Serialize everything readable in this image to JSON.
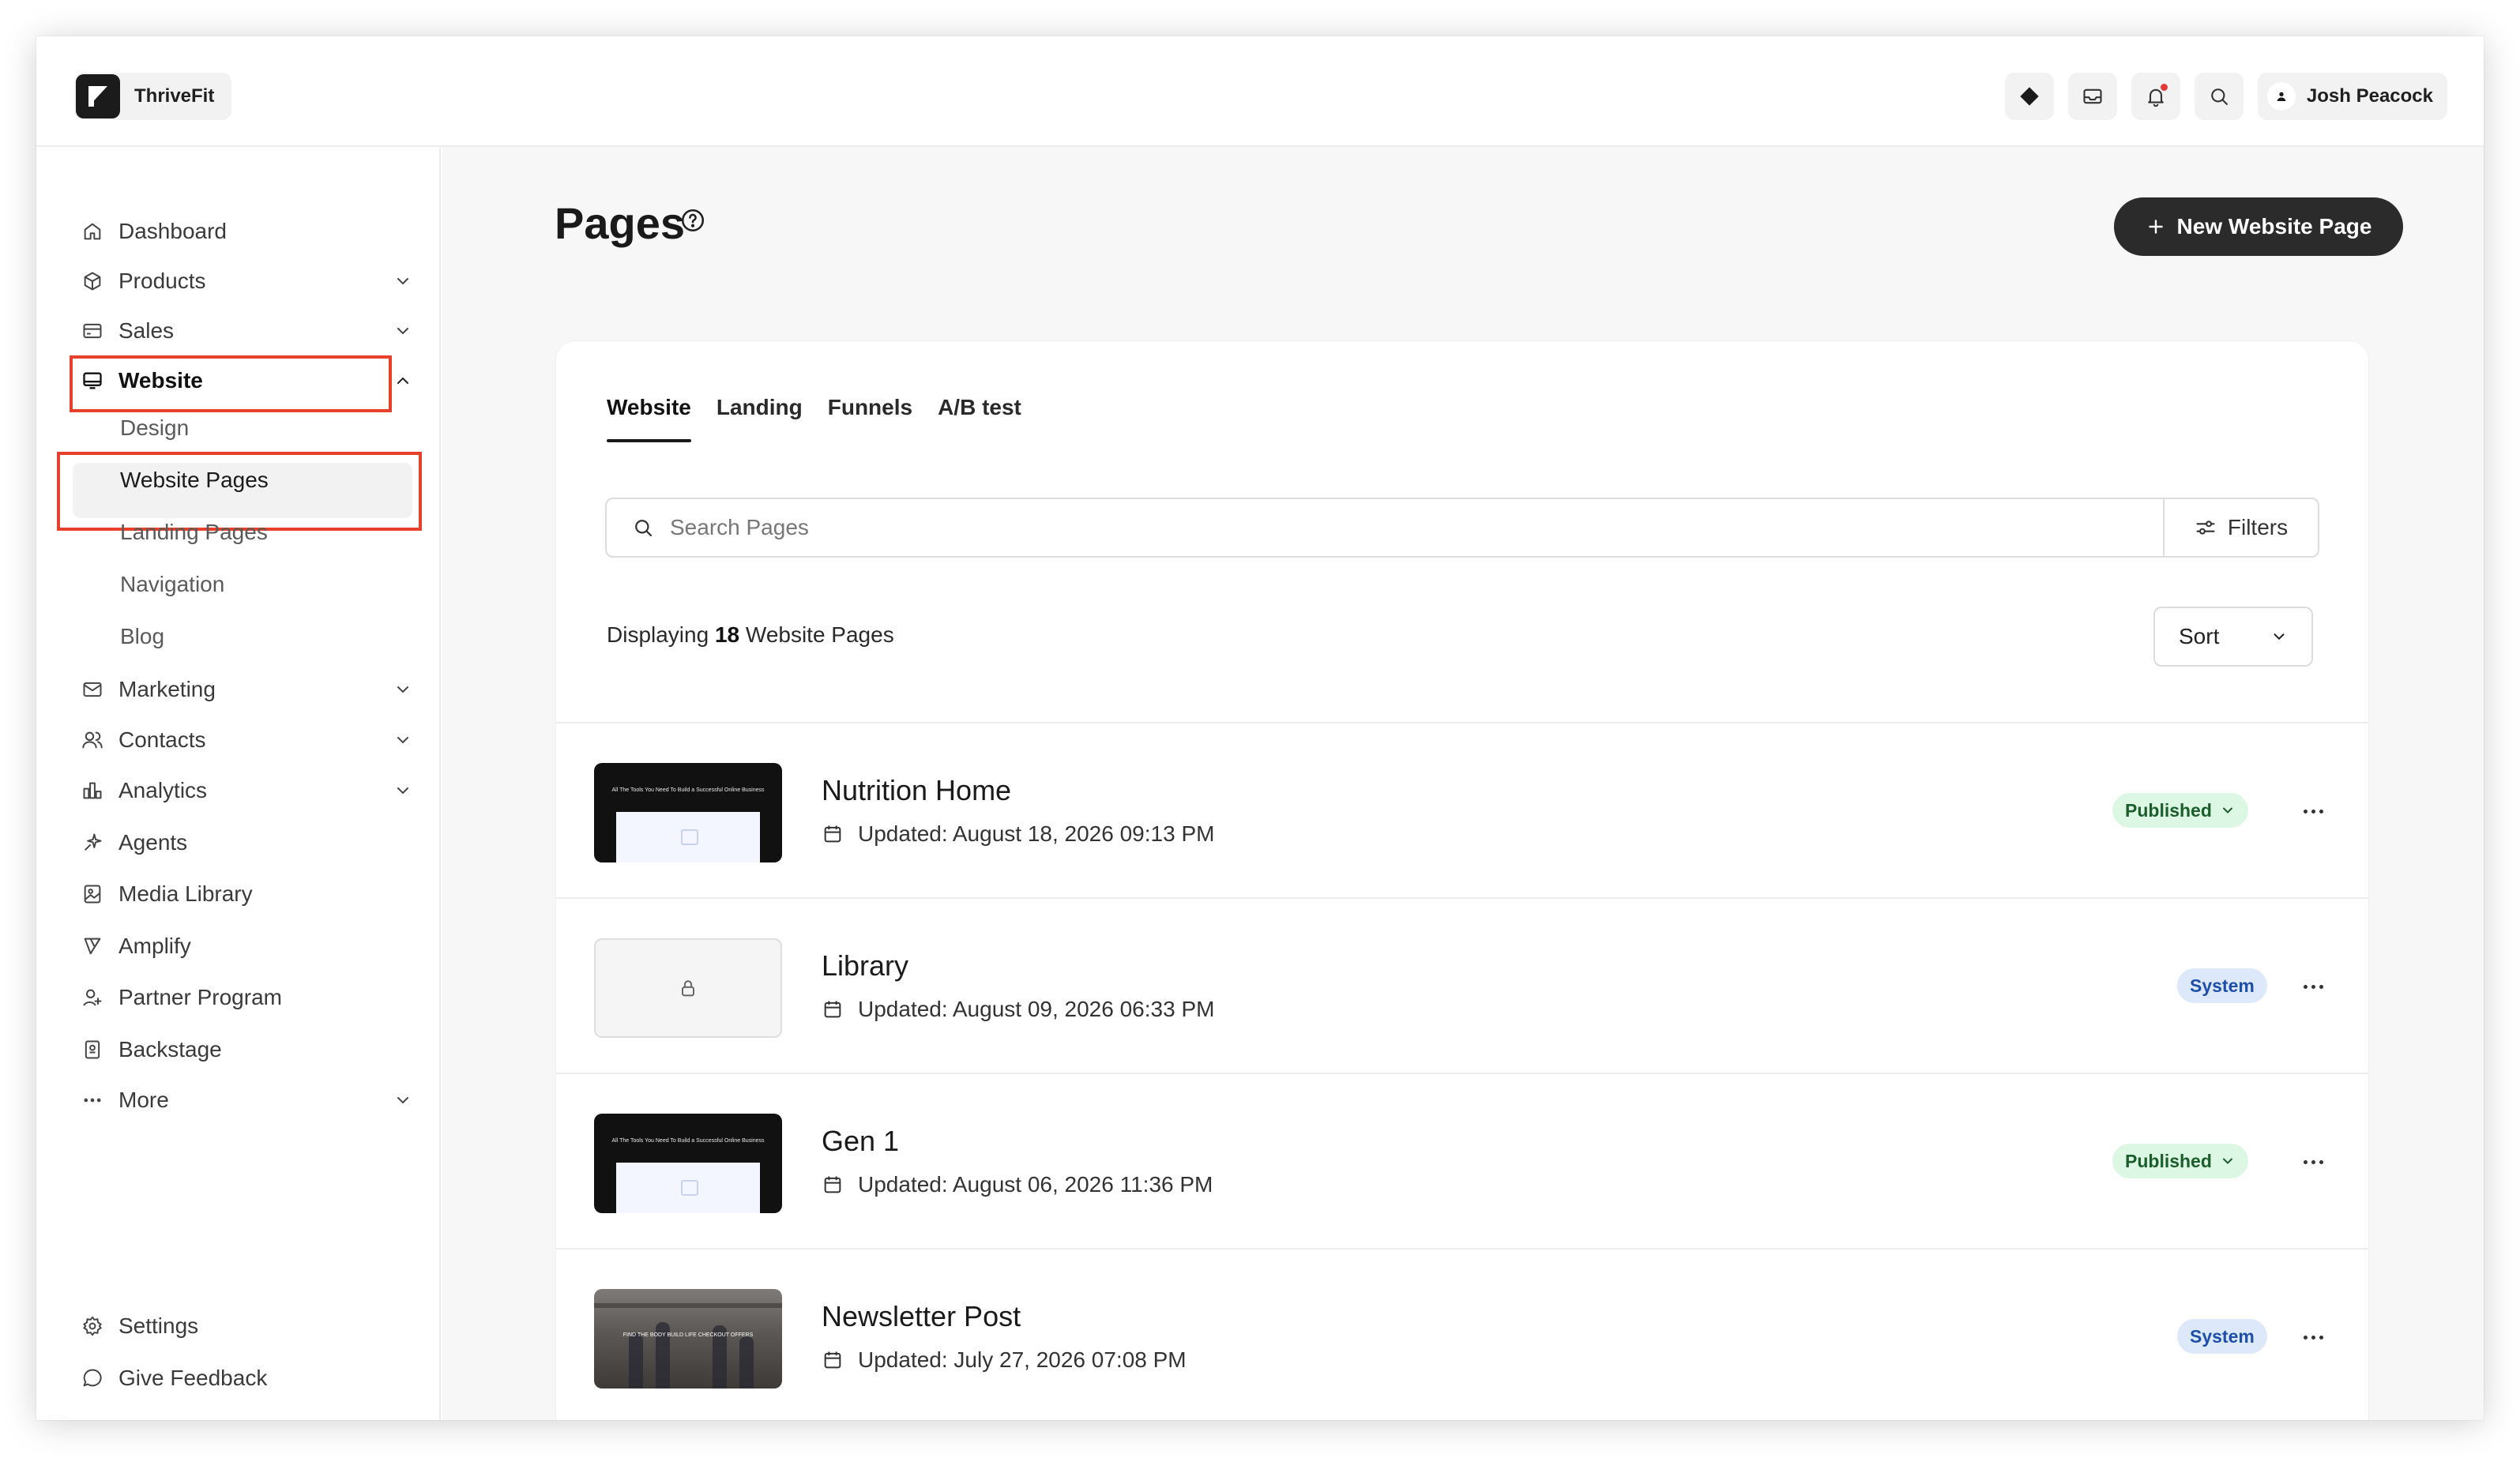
{
  "app": {
    "brand_name": "ThriveFit",
    "user_name": "Josh Peacock"
  },
  "header": {
    "icons": [
      "diamond-icon",
      "inbox-icon",
      "bell-icon",
      "search-icon",
      "user-icon"
    ],
    "notification_dot_color": "#e53935"
  },
  "sidebar": {
    "items": [
      {
        "label": "Dashboard",
        "icon": "home-icon"
      },
      {
        "label": "Products",
        "icon": "box-icon",
        "expandable": true
      },
      {
        "label": "Sales",
        "icon": "card-icon",
        "expandable": true
      },
      {
        "label": "Website",
        "icon": "monitor-icon",
        "expandable": true,
        "expanded": true
      },
      {
        "label": "Marketing",
        "icon": "mail-icon",
        "expandable": true
      },
      {
        "label": "Contacts",
        "icon": "users-icon",
        "expandable": true
      },
      {
        "label": "Analytics",
        "icon": "bar-chart-icon",
        "expandable": true
      },
      {
        "label": "Agents",
        "icon": "sparkle-icon"
      },
      {
        "label": "Media Library",
        "icon": "image-icon"
      },
      {
        "label": "Amplify",
        "icon": "megaphone-icon"
      },
      {
        "label": "Partner Program",
        "icon": "partner-icon"
      },
      {
        "label": "Backstage",
        "icon": "backstage-icon"
      },
      {
        "label": "More",
        "icon": "dots-icon",
        "expandable": true
      }
    ],
    "website_subitems": [
      "Design",
      "Website Pages",
      "Landing Pages",
      "Navigation",
      "Blog"
    ],
    "bottom_items": [
      {
        "label": "Settings",
        "icon": "gear-icon"
      },
      {
        "label": "Give Feedback",
        "icon": "chat-icon"
      }
    ],
    "highlight_color": "#e8412b"
  },
  "main": {
    "title": "Pages",
    "new_button_label": "New Website Page",
    "tabs": [
      "Website",
      "Landing",
      "Funnels",
      "A/B test"
    ],
    "active_tab": "Website",
    "search_placeholder": "Search Pages",
    "filters_label": "Filters",
    "count_prefix": "Displaying",
    "count_value": "18",
    "count_suffix": "Website Pages",
    "sort_label": "Sort",
    "pages": [
      {
        "title": "Nutrition Home",
        "updated": "Updated: August 18, 2026 09:13 PM",
        "status": "Published",
        "thumb": "dark",
        "thumb_text": "All The Tools You Need To Build a Successful Online Business"
      },
      {
        "title": "Library",
        "updated": "Updated: August 09, 2026 06:33 PM",
        "status": "System",
        "thumb": "lock"
      },
      {
        "title": "Gen 1",
        "updated": "Updated: August 06, 2026 11:36 PM",
        "status": "Published",
        "thumb": "dark",
        "thumb_text": "All The Tools You Need To Build a Successful Online Business"
      },
      {
        "title": "Newsletter Post",
        "updated": "Updated: July 27, 2026 07:08 PM",
        "status": "System",
        "thumb": "photo",
        "thumb_text": "FIND THE BODY BUILD LIFE CHECKOUT OFFERS"
      }
    ],
    "colors": {
      "published_bg": "#dcf7e3",
      "published_text": "#1b5e2c",
      "system_bg": "#dde9fb",
      "system_text": "#1e4fa8",
      "primary_button": "#2b2b2b"
    }
  }
}
